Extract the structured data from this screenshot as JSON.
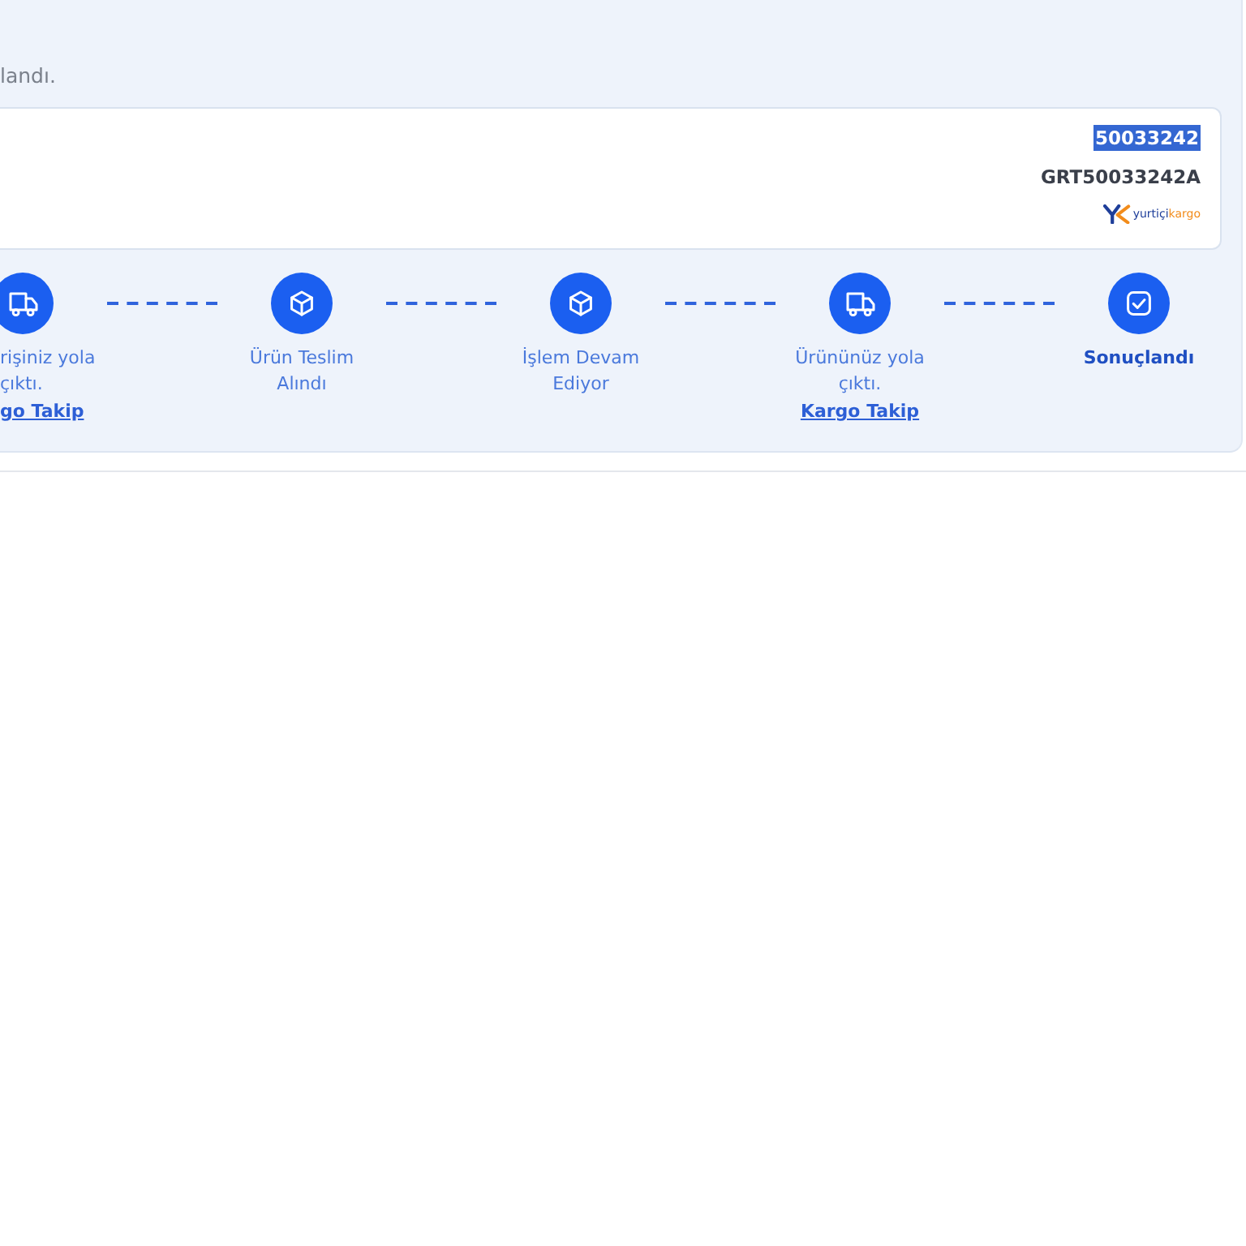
{
  "notice": {
    "text": "landı."
  },
  "shipment": {
    "number": {
      "text": "50033242",
      "highlighted": true
    },
    "code": "GRT50033242A",
    "carrier_logo": {
      "words": [
        "yurtiçi",
        "kargo"
      ]
    }
  },
  "steps": [
    {
      "kind": "shipped",
      "label": "rişiniz yola çıktı.",
      "link": "go Takip",
      "active": false
    },
    {
      "kind": "received",
      "label": "Ürün Teslim Alındı",
      "active": false
    },
    {
      "kind": "processing",
      "label": "İşlem Devam Ediyor",
      "active": false
    },
    {
      "kind": "shipped",
      "label": "Ürününüz yola çıktı.",
      "link": "Kargo Takip",
      "active": false
    },
    {
      "kind": "completed",
      "label": "Sonuçlandı",
      "active": true
    }
  ]
}
